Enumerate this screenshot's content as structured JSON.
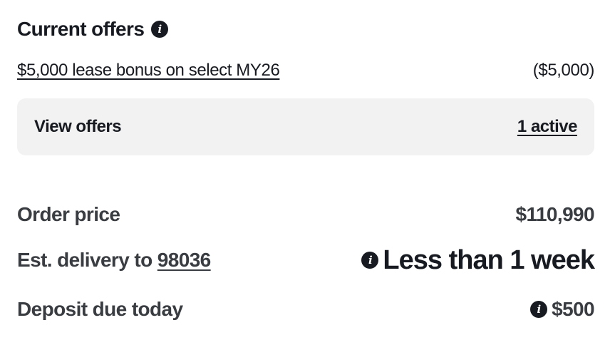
{
  "offers": {
    "title": "Current offers",
    "offer_label": "$5,000 lease bonus on select MY26",
    "offer_amount": "($5,000)",
    "view_offers_label": "View offers",
    "active_count_label": "1 active"
  },
  "summary": {
    "order_price_label": "Order price",
    "order_price_value": "$110,990",
    "delivery_label_prefix": "Est. delivery to",
    "delivery_zip": "98036",
    "delivery_value": "Less than 1 week",
    "deposit_label": "Deposit due today",
    "deposit_value": "$500"
  },
  "icons": {
    "info": "info-icon"
  }
}
